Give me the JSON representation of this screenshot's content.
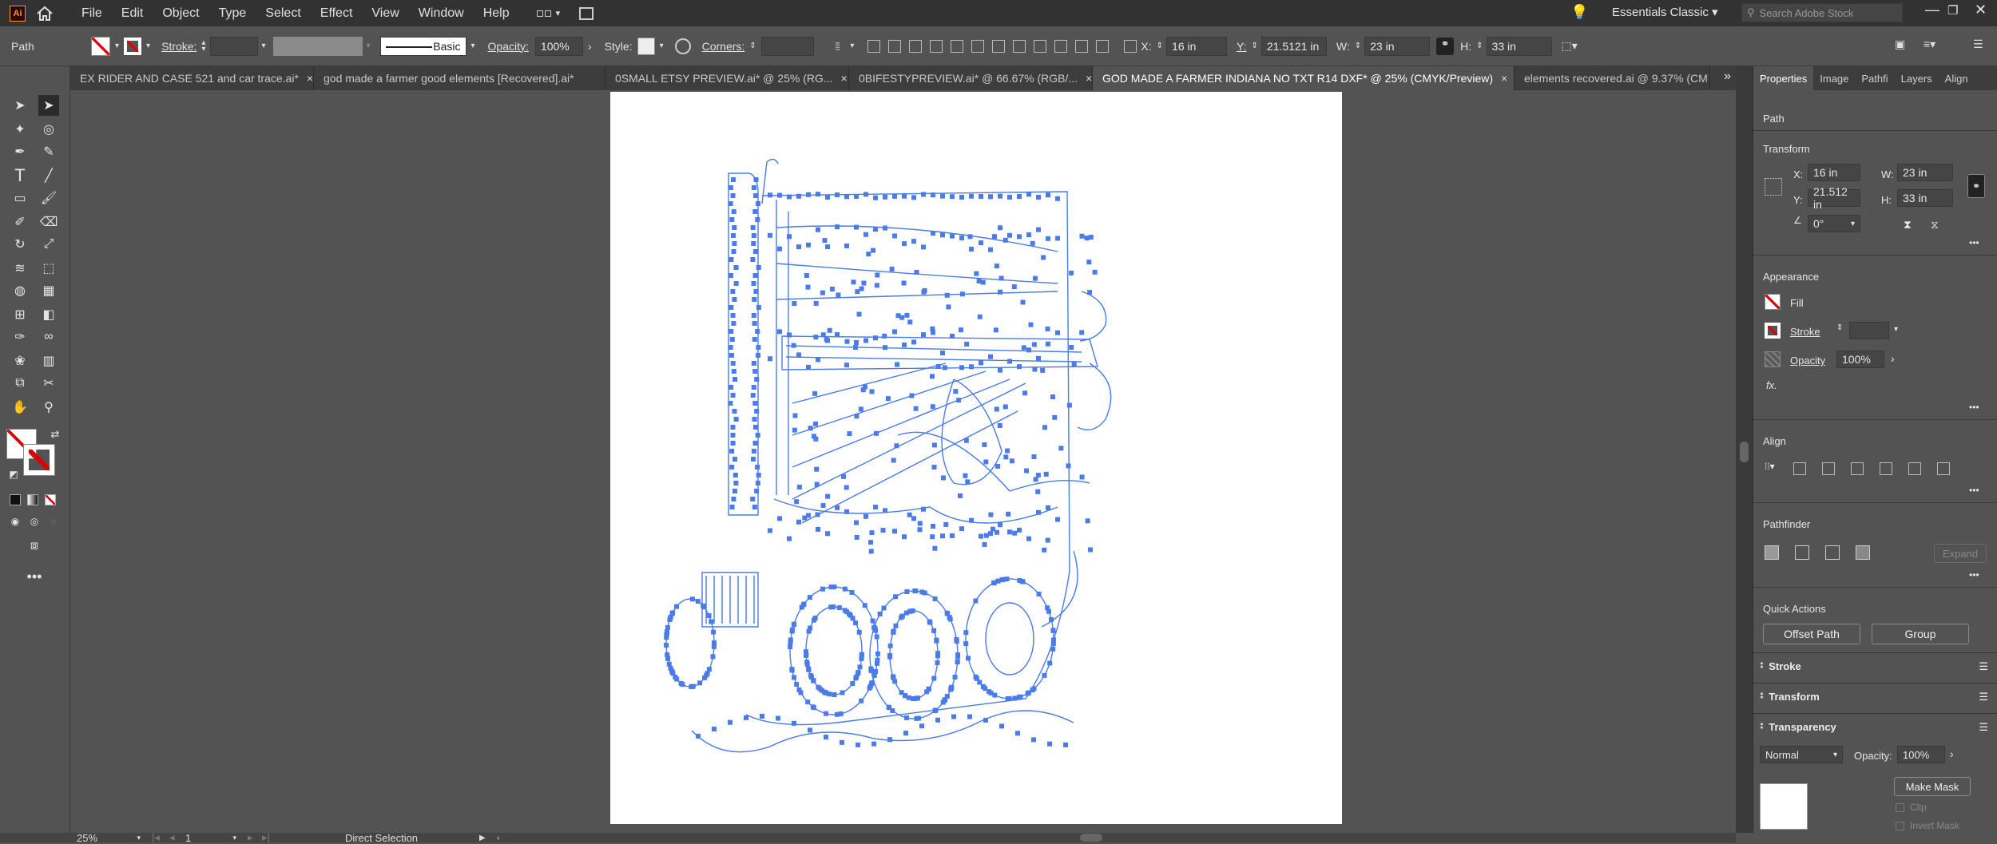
{
  "app": {
    "logo": "Ai"
  },
  "menu": [
    "File",
    "Edit",
    "Object",
    "Type",
    "Select",
    "Effect",
    "View",
    "Window",
    "Help"
  ],
  "workspace": {
    "name": "Essentials Classic",
    "search_placeholder": "Search Adobe Stock"
  },
  "control_bar": {
    "object_type": "Path",
    "stroke_label": "Stroke:",
    "brush_label": "Basic",
    "opacity_label": "Opacity:",
    "opacity_value": "100%",
    "style_label": "Style:",
    "corners_label": "Corners:",
    "x_label": "X:",
    "x_value": "16 in",
    "y_label": "Y:",
    "y_value": "21.5121 in",
    "w_label": "W:",
    "w_value": "23 in",
    "h_label": "H:",
    "h_value": "33 in"
  },
  "tabs": [
    {
      "label": "EX RIDER AND CASE 521 and car trace.ai*",
      "active": false
    },
    {
      "label": "god made a farmer good elements [Recovered].ai*",
      "active": false
    },
    {
      "label": "0SMALL ETSY PREVIEW.ai* @ 25% (RG...",
      "active": false
    },
    {
      "label": "0BIFESTYPREVIEW.ai* @ 66.67% (RGB/...",
      "active": false
    },
    {
      "label": "GOD MADE A FARMER INDIANA NO TXT R14 DXF* @ 25% (CMYK/Preview)",
      "active": true
    },
    {
      "label": "elements recovered.ai @ 9.37% (CM",
      "active": false
    }
  ],
  "tab_close": "×",
  "overflow": "»",
  "panel": {
    "tabs": [
      "Properties",
      "Image",
      "Pathfi",
      "Layers",
      "Align"
    ],
    "object_type": "Path",
    "transform": {
      "title": "Transform",
      "x_label": "X:",
      "x": "16 in",
      "y_label": "Y:",
      "y": "21.512 in",
      "w_label": "W:",
      "w": "23 in",
      "h_label": "H:",
      "h": "33 in",
      "angle": "0°"
    },
    "appearance": {
      "title": "Appearance",
      "fill": "Fill",
      "stroke": "Stroke",
      "opacity_label": "Opacity",
      "opacity": "100%",
      "fx": "fx."
    },
    "align_title": "Align",
    "pathfinder": {
      "title": "Pathfinder",
      "expand": "Expand"
    },
    "quick_actions": {
      "title": "Quick Actions",
      "offset_path": "Offset Path",
      "group": "Group"
    },
    "collapsed": [
      "Stroke",
      "Transform",
      "Transparency"
    ],
    "transparency": {
      "mode": "Normal",
      "opacity_label": "Opacity:",
      "opacity": "100%",
      "make_mask": "Make Mask",
      "clip": "Clip",
      "invert": "Invert Mask"
    }
  },
  "status": {
    "zoom": "25%",
    "artboard": "1",
    "tool": "Direct Selection"
  },
  "colors": {
    "path": "#4a7be8",
    "accent": "#ff9a00"
  }
}
